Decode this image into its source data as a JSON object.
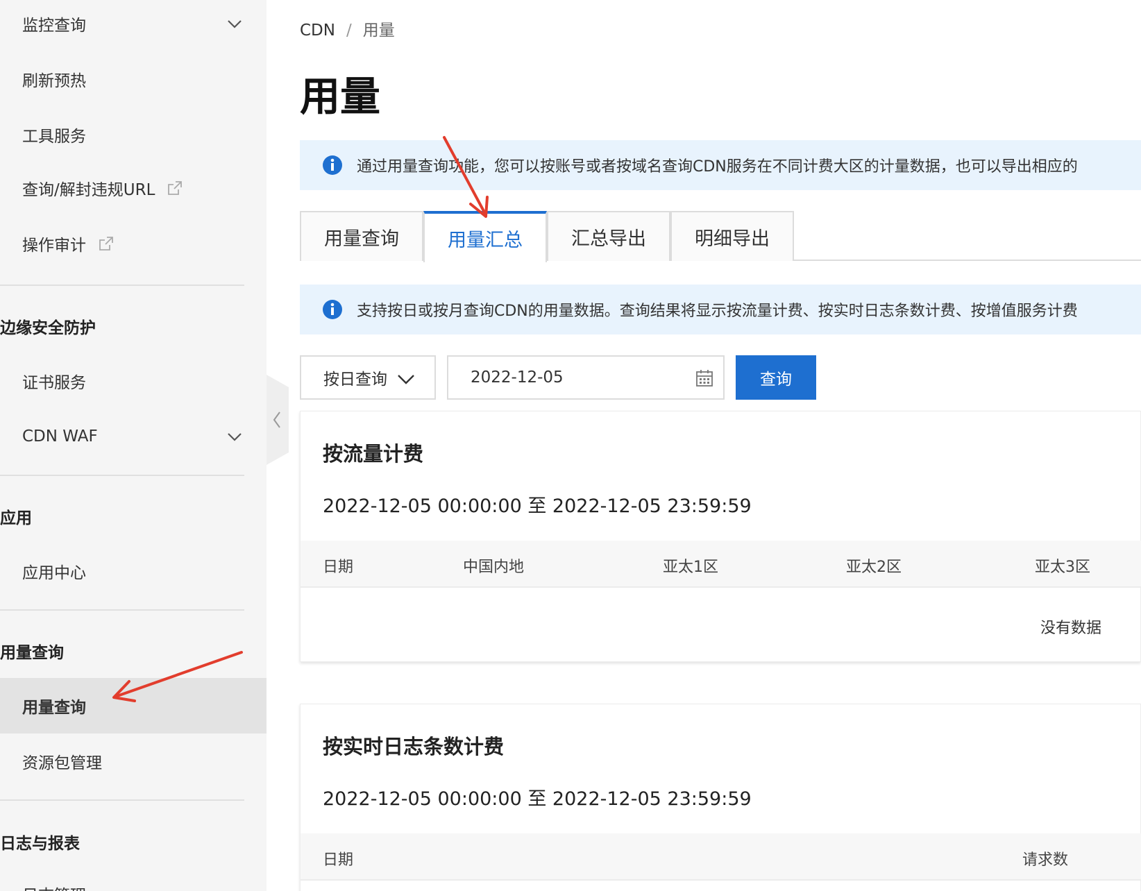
{
  "sidebar": {
    "items": [
      {
        "label": "监控查询",
        "chevron": true
      },
      {
        "label": "刷新预热"
      },
      {
        "label": "工具服务"
      },
      {
        "label": "查询/解封违规URL",
        "external": true
      },
      {
        "label": "操作审计",
        "external": true
      }
    ],
    "groups": [
      {
        "title": "边缘安全防护",
        "items": [
          {
            "label": "证书服务"
          },
          {
            "label": "CDN WAF",
            "chevron": true
          }
        ]
      },
      {
        "title": "应用",
        "items": [
          {
            "label": "应用中心"
          }
        ]
      },
      {
        "title": "用量查询",
        "items": [
          {
            "label": "用量查询",
            "active": true
          },
          {
            "label": "资源包管理"
          }
        ]
      },
      {
        "title": "日志与报表",
        "items": [
          {
            "label": "日志管理"
          }
        ]
      }
    ]
  },
  "breadcrumb": {
    "root": "CDN",
    "separator": "/",
    "current": "用量"
  },
  "page_title": "用量",
  "notice": "通过用量查询功能，您可以按账号或者按域名查询CDN服务在不同计费大区的计量数据，也可以导出相应的",
  "tabs": [
    {
      "label": "用量查询"
    },
    {
      "label": "用量汇总",
      "active": true
    },
    {
      "label": "汇总导出"
    },
    {
      "label": "明细导出"
    }
  ],
  "sub_notice": "支持按日或按月查询CDN的用量数据。查询结果将显示按流量计费、按实时日志条数计费、按增值服务计费",
  "filters": {
    "period_select": "按日查询",
    "date_value": "2022-12-05",
    "query_button": "查询"
  },
  "cards": [
    {
      "title": "按流量计费",
      "range": "2022-12-05 00:00:00 至 2022-12-05 23:59:59",
      "columns": [
        "日期",
        "中国内地",
        "亚太1区",
        "亚太2区",
        "亚太3区"
      ],
      "empty_text": "没有数据"
    },
    {
      "title": "按实时日志条数计费",
      "range": "2022-12-05 00:00:00 至 2022-12-05 23:59:59",
      "columns": [
        "日期",
        "请求数"
      ]
    }
  ],
  "colors": {
    "accent": "#1e6fd0",
    "annotation_arrow": "#e23d2d",
    "sidebar_bg": "#f5f5f5",
    "notice_bg": "#e8f3fd"
  }
}
